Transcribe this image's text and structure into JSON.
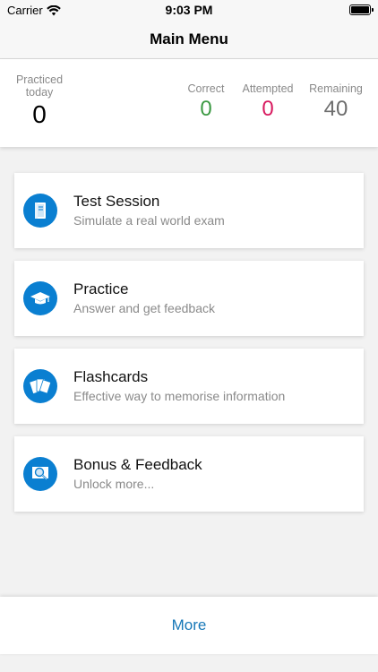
{
  "status_bar": {
    "carrier": "Carrier",
    "time": "9:03 PM"
  },
  "nav": {
    "title": "Main Menu"
  },
  "stats": {
    "practiced_label": "Practiced today",
    "practiced_value": "0",
    "correct_label": "Correct",
    "correct_value": "0",
    "attempted_label": "Attempted",
    "attempted_value": "0",
    "remaining_label": "Remaining",
    "remaining_value": "40",
    "colors": {
      "correct": "#3d9a44",
      "attempted": "#d81b60",
      "remaining": "#6e6e6e"
    }
  },
  "menu": {
    "items": [
      {
        "title": "Test Session",
        "subtitle": "Simulate a real world exam",
        "icon": "document-icon"
      },
      {
        "title": "Practice",
        "subtitle": "Answer and get feedback",
        "icon": "graduation-cap-icon"
      },
      {
        "title": "Flashcards",
        "subtitle": "Effective way to memorise information",
        "icon": "flashcards-icon"
      },
      {
        "title": "Bonus & Feedback",
        "subtitle": "Unlock more...",
        "icon": "magnifier-icon"
      }
    ]
  },
  "bottom": {
    "more_label": "More"
  },
  "colors": {
    "accent": "#0a7fd1",
    "link": "#1778b8"
  }
}
